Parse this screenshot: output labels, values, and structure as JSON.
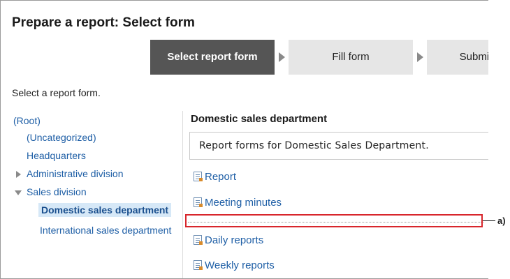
{
  "page": {
    "title": "Prepare a report: Select form"
  },
  "steps": [
    {
      "label": "Select report form",
      "active": true
    },
    {
      "label": "Fill form",
      "active": false
    },
    {
      "label": "Submit",
      "active": false
    }
  ],
  "instruction": "Select a report form.",
  "tree": {
    "root": "(Root)",
    "uncategorized": "(Uncategorized)",
    "headquarters": "Headquarters",
    "administrative": "Administrative division",
    "sales": "Sales division",
    "domestic": "Domestic sales department",
    "international": "International sales department"
  },
  "content": {
    "category_title": "Domestic sales department",
    "description": "Report forms for Domestic Sales Department.",
    "forms": [
      "Report",
      "Meeting minutes",
      "Daily reports",
      "Weekly reports"
    ]
  },
  "annotation": {
    "label": "a)"
  },
  "colors": {
    "link": "#1f5fa6",
    "active_step": "#555555",
    "highlight": "#d8262c",
    "selected_bg": "#d6e8f7"
  }
}
